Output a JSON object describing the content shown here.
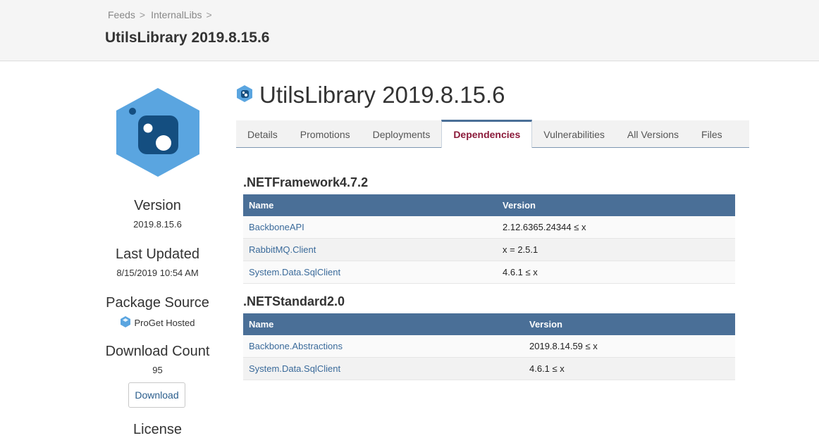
{
  "breadcrumbs": [
    "Feeds",
    "InternalLibs"
  ],
  "header": {
    "title": "UtilsLibrary 2019.8.15.6"
  },
  "package": {
    "title": "UtilsLibrary 2019.8.15.6",
    "meta": {
      "version_label": "Version",
      "version_value": "2019.8.15.6",
      "updated_label": "Last Updated",
      "updated_value": "8/15/2019 10:54 AM",
      "source_label": "Package Source",
      "source_value": "ProGet Hosted",
      "downloads_label": "Download Count",
      "downloads_value": "95",
      "license_label": "License"
    },
    "download_button": "Download",
    "icon": "nuget-package-icon",
    "accent_color": "#5aa5e0"
  },
  "tabs": [
    {
      "label": "Details",
      "active": false
    },
    {
      "label": "Promotions",
      "active": false
    },
    {
      "label": "Deployments",
      "active": false
    },
    {
      "label": "Dependencies",
      "active": true
    },
    {
      "label": "Vulnerabilities",
      "active": false
    },
    {
      "label": "All Versions",
      "active": false
    },
    {
      "label": "Files",
      "active": false
    }
  ],
  "dependency_groups": [
    {
      "framework": ".NETFramework4.7.2",
      "columns": [
        "Name",
        "Version"
      ],
      "rows": [
        {
          "name": "BackboneAPI",
          "version": "2.12.6365.24344 ≤ x"
        },
        {
          "name": "RabbitMQ.Client",
          "version": "x = 2.5.1"
        },
        {
          "name": "System.Data.SqlClient",
          "version": "4.6.1 ≤ x"
        }
      ]
    },
    {
      "framework": ".NETStandard2.0",
      "columns": [
        "Name",
        "Version"
      ],
      "rows": [
        {
          "name": "Backbone.Abstractions",
          "version": "2019.8.14.59 ≤ x"
        },
        {
          "name": "System.Data.SqlClient",
          "version": "4.6.1 ≤ x"
        }
      ]
    }
  ],
  "colors": {
    "table_header": "#4a6f97",
    "active_tab_text": "#8b1a3a",
    "link": "#3a6a9a"
  }
}
